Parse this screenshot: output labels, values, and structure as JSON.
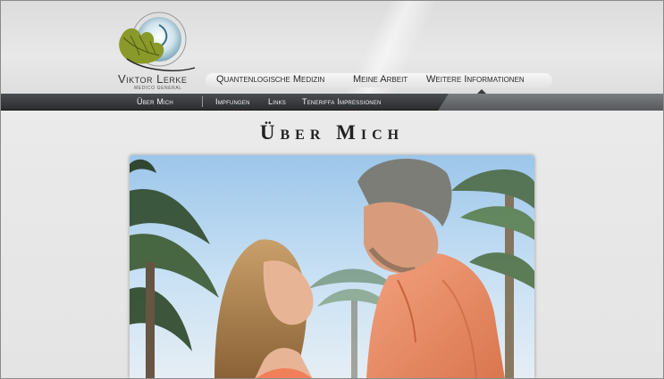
{
  "logo": {
    "name": "Viktor Lerke",
    "subtitle": "MEDICO GENERAL",
    "icon": "leaf-circle-logo"
  },
  "main_nav": {
    "items": [
      {
        "label": "Quantenlogische Medizin"
      },
      {
        "label": "Meine Arbeit"
      },
      {
        "label": "Weitere Informationen"
      }
    ],
    "active_index": 2
  },
  "sub_nav": {
    "items": [
      {
        "label": "Über Mich"
      },
      {
        "label": "Impfungen"
      },
      {
        "label": "Links"
      },
      {
        "label": "Teneriffa Impressionen"
      }
    ],
    "active_index": 0
  },
  "page": {
    "title": "Über Mich"
  },
  "photo": {
    "description_icon": "couple-photo"
  },
  "colors": {
    "subnav_bg": "#2b2d30",
    "subnav_highlight": "#6b6e71",
    "text": "#222222",
    "page_bg": "#e9e9e9"
  }
}
